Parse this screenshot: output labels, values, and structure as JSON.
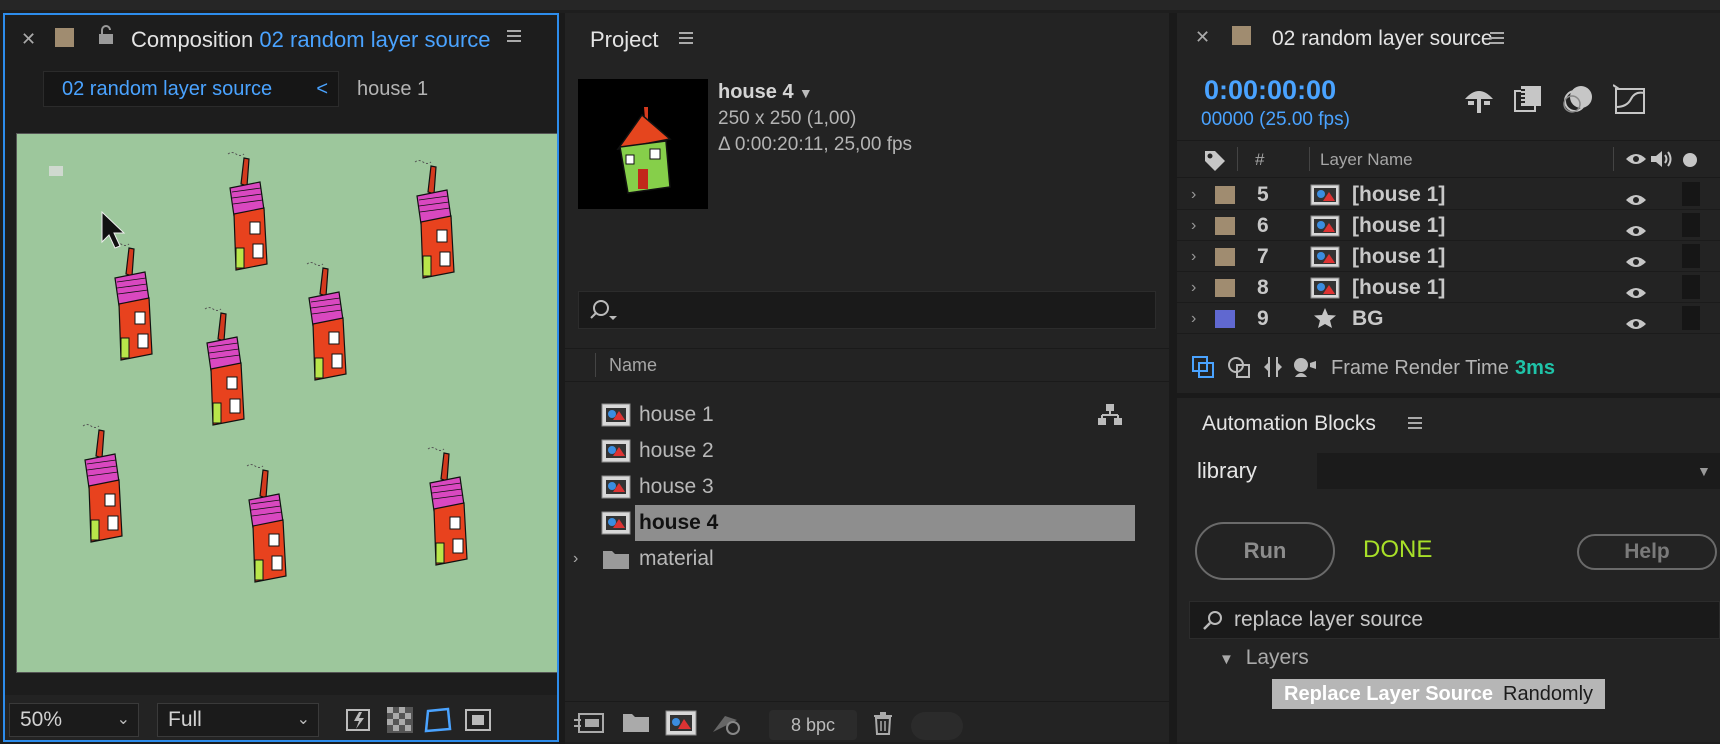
{
  "composition": {
    "title_prefix": "Composition",
    "title_name": "02 random layer source",
    "breadcrumb_active": "02 random layer source",
    "breadcrumb_chevron": "<",
    "breadcrumb_next": "house 1",
    "zoom": "50%",
    "resolution": "Full"
  },
  "project": {
    "title": "Project",
    "selected_name": "house 4",
    "selected_dims": "250 x 250 (1,00)",
    "selected_duration": "Δ 0:00:20:11, 25,00 fps",
    "column_name": "Name",
    "items": [
      {
        "label": "house 1",
        "selected": false,
        "type": "comp"
      },
      {
        "label": "house 2",
        "selected": false,
        "type": "comp"
      },
      {
        "label": "house 3",
        "selected": false,
        "type": "comp"
      },
      {
        "label": "house 4",
        "selected": true,
        "type": "comp"
      },
      {
        "label": "material",
        "selected": false,
        "type": "folder"
      }
    ],
    "bit_depth": "8 bpc"
  },
  "timeline": {
    "title": "02 random layer source",
    "timecode": "0:00:00:00",
    "frames_fps": "00000 (25.00 fps)",
    "col_num": "#",
    "col_layer": "Layer Name",
    "layers": [
      {
        "num": "5",
        "name": "[house 1]",
        "color": "#a08c70"
      },
      {
        "num": "6",
        "name": "[house 1]",
        "color": "#a08c70"
      },
      {
        "num": "7",
        "name": "[house 1]",
        "color": "#a08c70"
      },
      {
        "num": "8",
        "name": "[house 1]",
        "color": "#a08c70"
      },
      {
        "num": "9",
        "name": "BG",
        "color": "#6068d0"
      }
    ],
    "footer_label": "Frame Render Time",
    "footer_value": "3ms"
  },
  "automation": {
    "title": "Automation Blocks",
    "tab": "library",
    "run_label": "Run",
    "status": "DONE",
    "help_label": "Help",
    "search_value": "replace layer source",
    "tree_group": "Layers",
    "block_main": "Replace Layer Source",
    "block_param": "Randomly"
  },
  "colors": {
    "accent_blue": "#4aa3ff",
    "done_green": "#a8e028",
    "render_teal": "#1fc3a8",
    "viewer_bg": "#9dc79c"
  }
}
